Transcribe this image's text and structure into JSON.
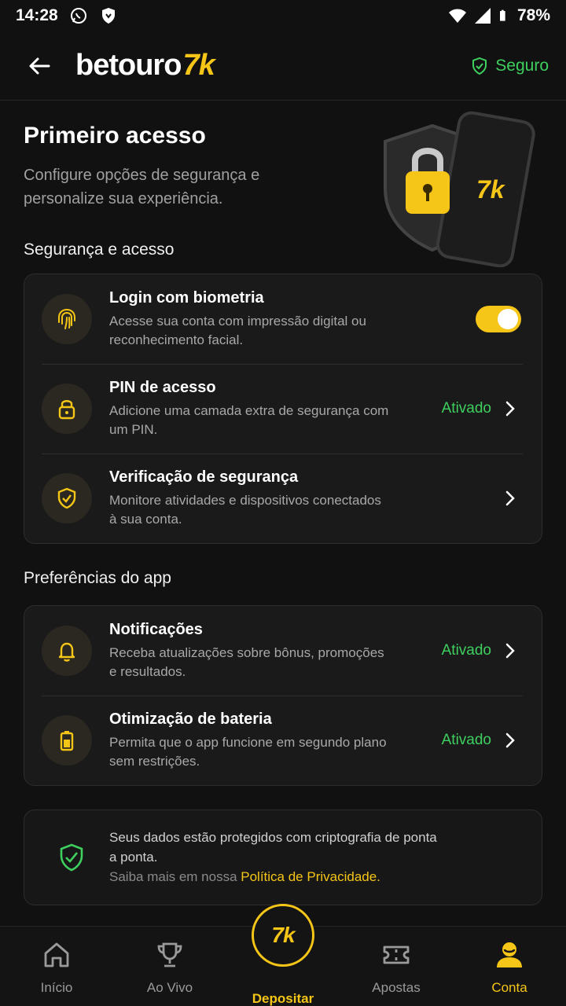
{
  "status_bar": {
    "time": "14:28",
    "battery": "78%"
  },
  "header": {
    "brand_name": "betouro",
    "brand_mark": "7k",
    "secure_label": "Seguro"
  },
  "hero": {
    "title": "Primeiro acesso",
    "subtitle": "Configure opções de segurança e personalize sua experiência.",
    "art_mark": "7k"
  },
  "security": {
    "section_title": "Segurança e acesso",
    "items": [
      {
        "title": "Login com biometria",
        "desc": "Acesse sua conta com impressão digital ou reconhecimento facial.",
        "toggle_on": true
      },
      {
        "title": "PIN de acesso",
        "desc": "Adicione uma camada extra de segurança com um PIN.",
        "status": "Ativado"
      },
      {
        "title": "Verificação de segurança",
        "desc": "Monitore atividades e dispositivos conectados à sua conta.",
        "status": ""
      }
    ]
  },
  "preferences": {
    "section_title": "Preferências do app",
    "items": [
      {
        "title": "Notificações",
        "desc": "Receba atualizações sobre bônus, promoções e resultados.",
        "status": "Ativado"
      },
      {
        "title": "Otimização de bateria",
        "desc": "Permita que o app funcione em segundo plano sem restrições.",
        "status": "Ativado"
      }
    ]
  },
  "privacy": {
    "line1": "Seus dados estão protegidos com criptografia de ponta a ponta.",
    "line2_prefix": "Saiba mais em nossa ",
    "line2_link": "Política de Privacidade."
  },
  "bottom_nav": {
    "items": [
      {
        "label": "Início",
        "icon": "home-icon"
      },
      {
        "label": "Ao Vivo",
        "icon": "trophy-icon"
      },
      {
        "label": "Depositar",
        "icon": "brand-7k-icon"
      },
      {
        "label": "Apostas",
        "icon": "ticket-icon"
      },
      {
        "label": "Conta",
        "icon": "user-icon"
      }
    ],
    "fab_mark": "7k"
  },
  "colors": {
    "accent": "#f5c518",
    "success": "#3ecf5f",
    "background": "#111111",
    "card": "#1a1a1a"
  }
}
